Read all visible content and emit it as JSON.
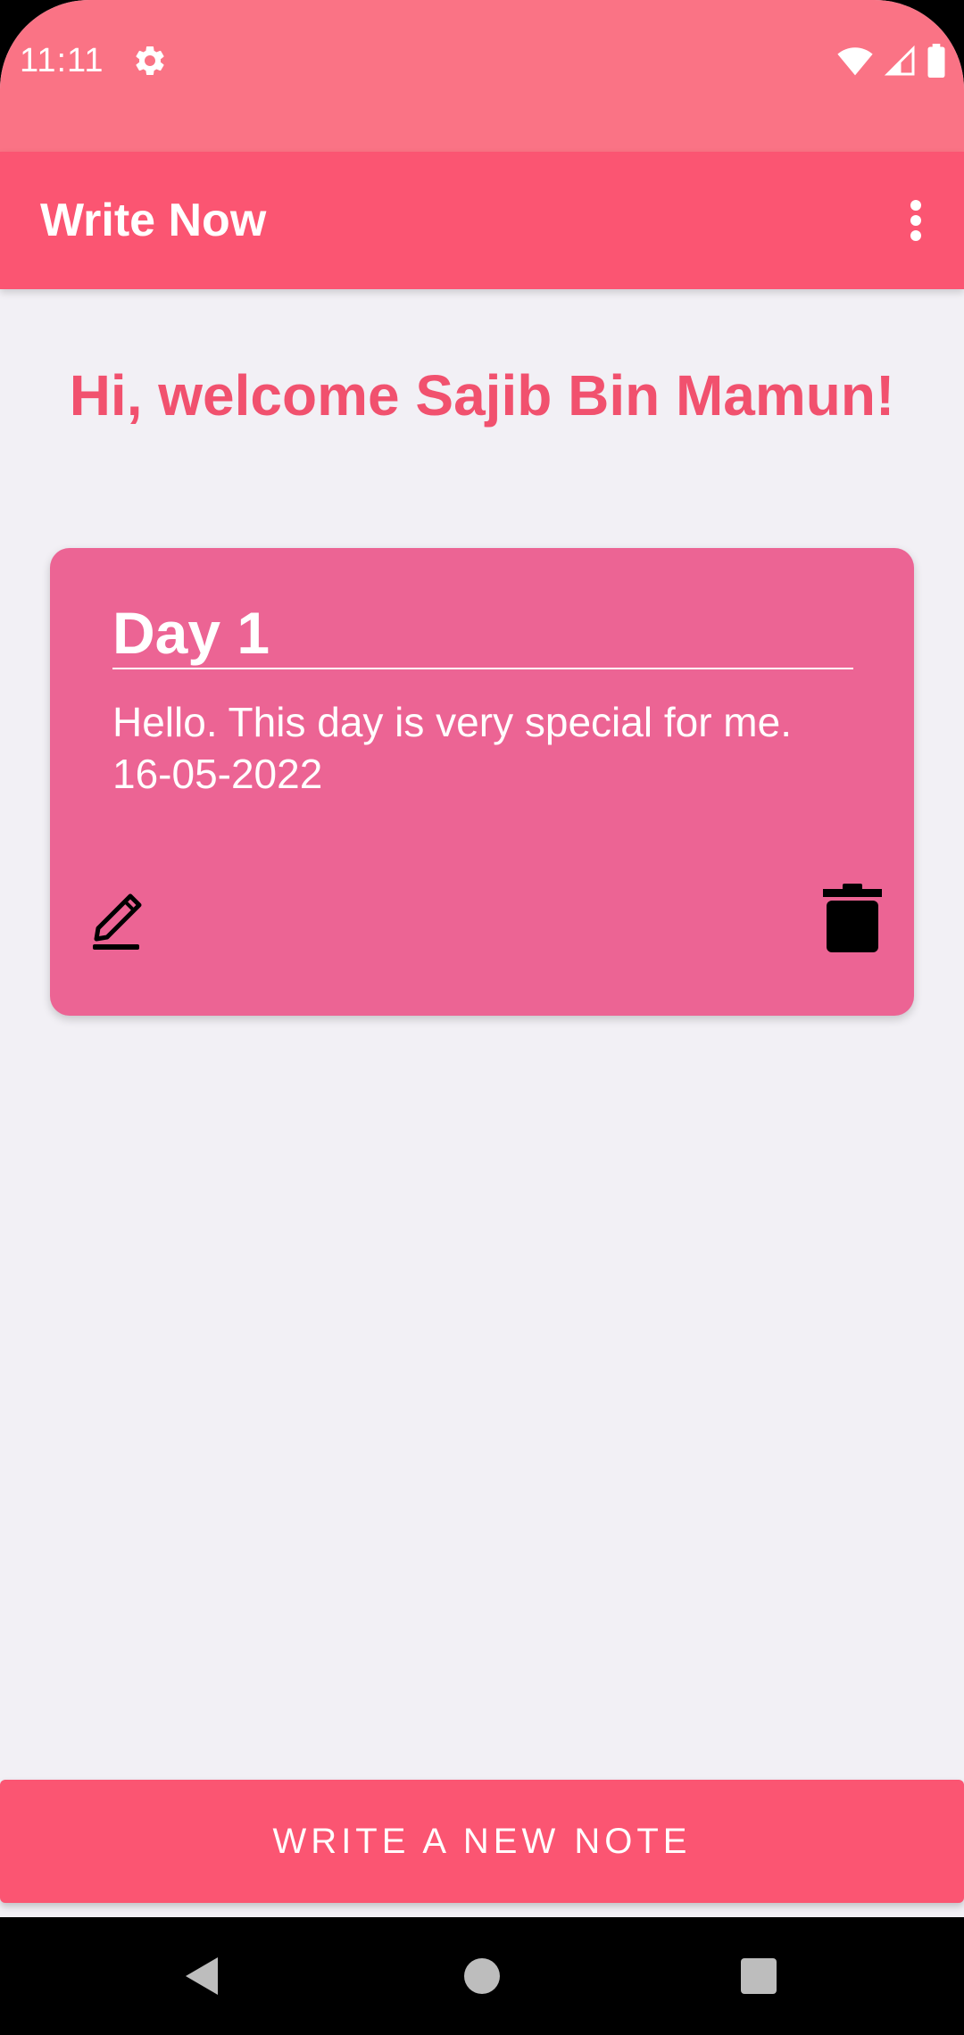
{
  "status_bar": {
    "time": "11:11",
    "icons": [
      "settings-gear-icon",
      "wifi-icon",
      "cell-signal-icon",
      "battery-icon"
    ]
  },
  "app_bar": {
    "title": "Write Now",
    "overflow_icon": "more-vert-icon"
  },
  "welcome": {
    "text": "Hi, welcome Sajib Bin Mamun!"
  },
  "notes": [
    {
      "title": "Day 1",
      "body": "Hello.  This day is very special for me. 16-05-2022",
      "edit_icon": "edit-pencil-icon",
      "delete_icon": "trash-icon"
    }
  ],
  "actions": {
    "write_new_note": "WRITE A NEW NOTE"
  },
  "nav_bar": {
    "icons": [
      "back-icon",
      "home-icon",
      "recents-icon"
    ]
  },
  "colors": {
    "status_bar": "#fa7385",
    "app_bar": "#fb5572",
    "accent_text": "#f1516e",
    "card": "#ec6494",
    "background": "#f2f0f5"
  }
}
